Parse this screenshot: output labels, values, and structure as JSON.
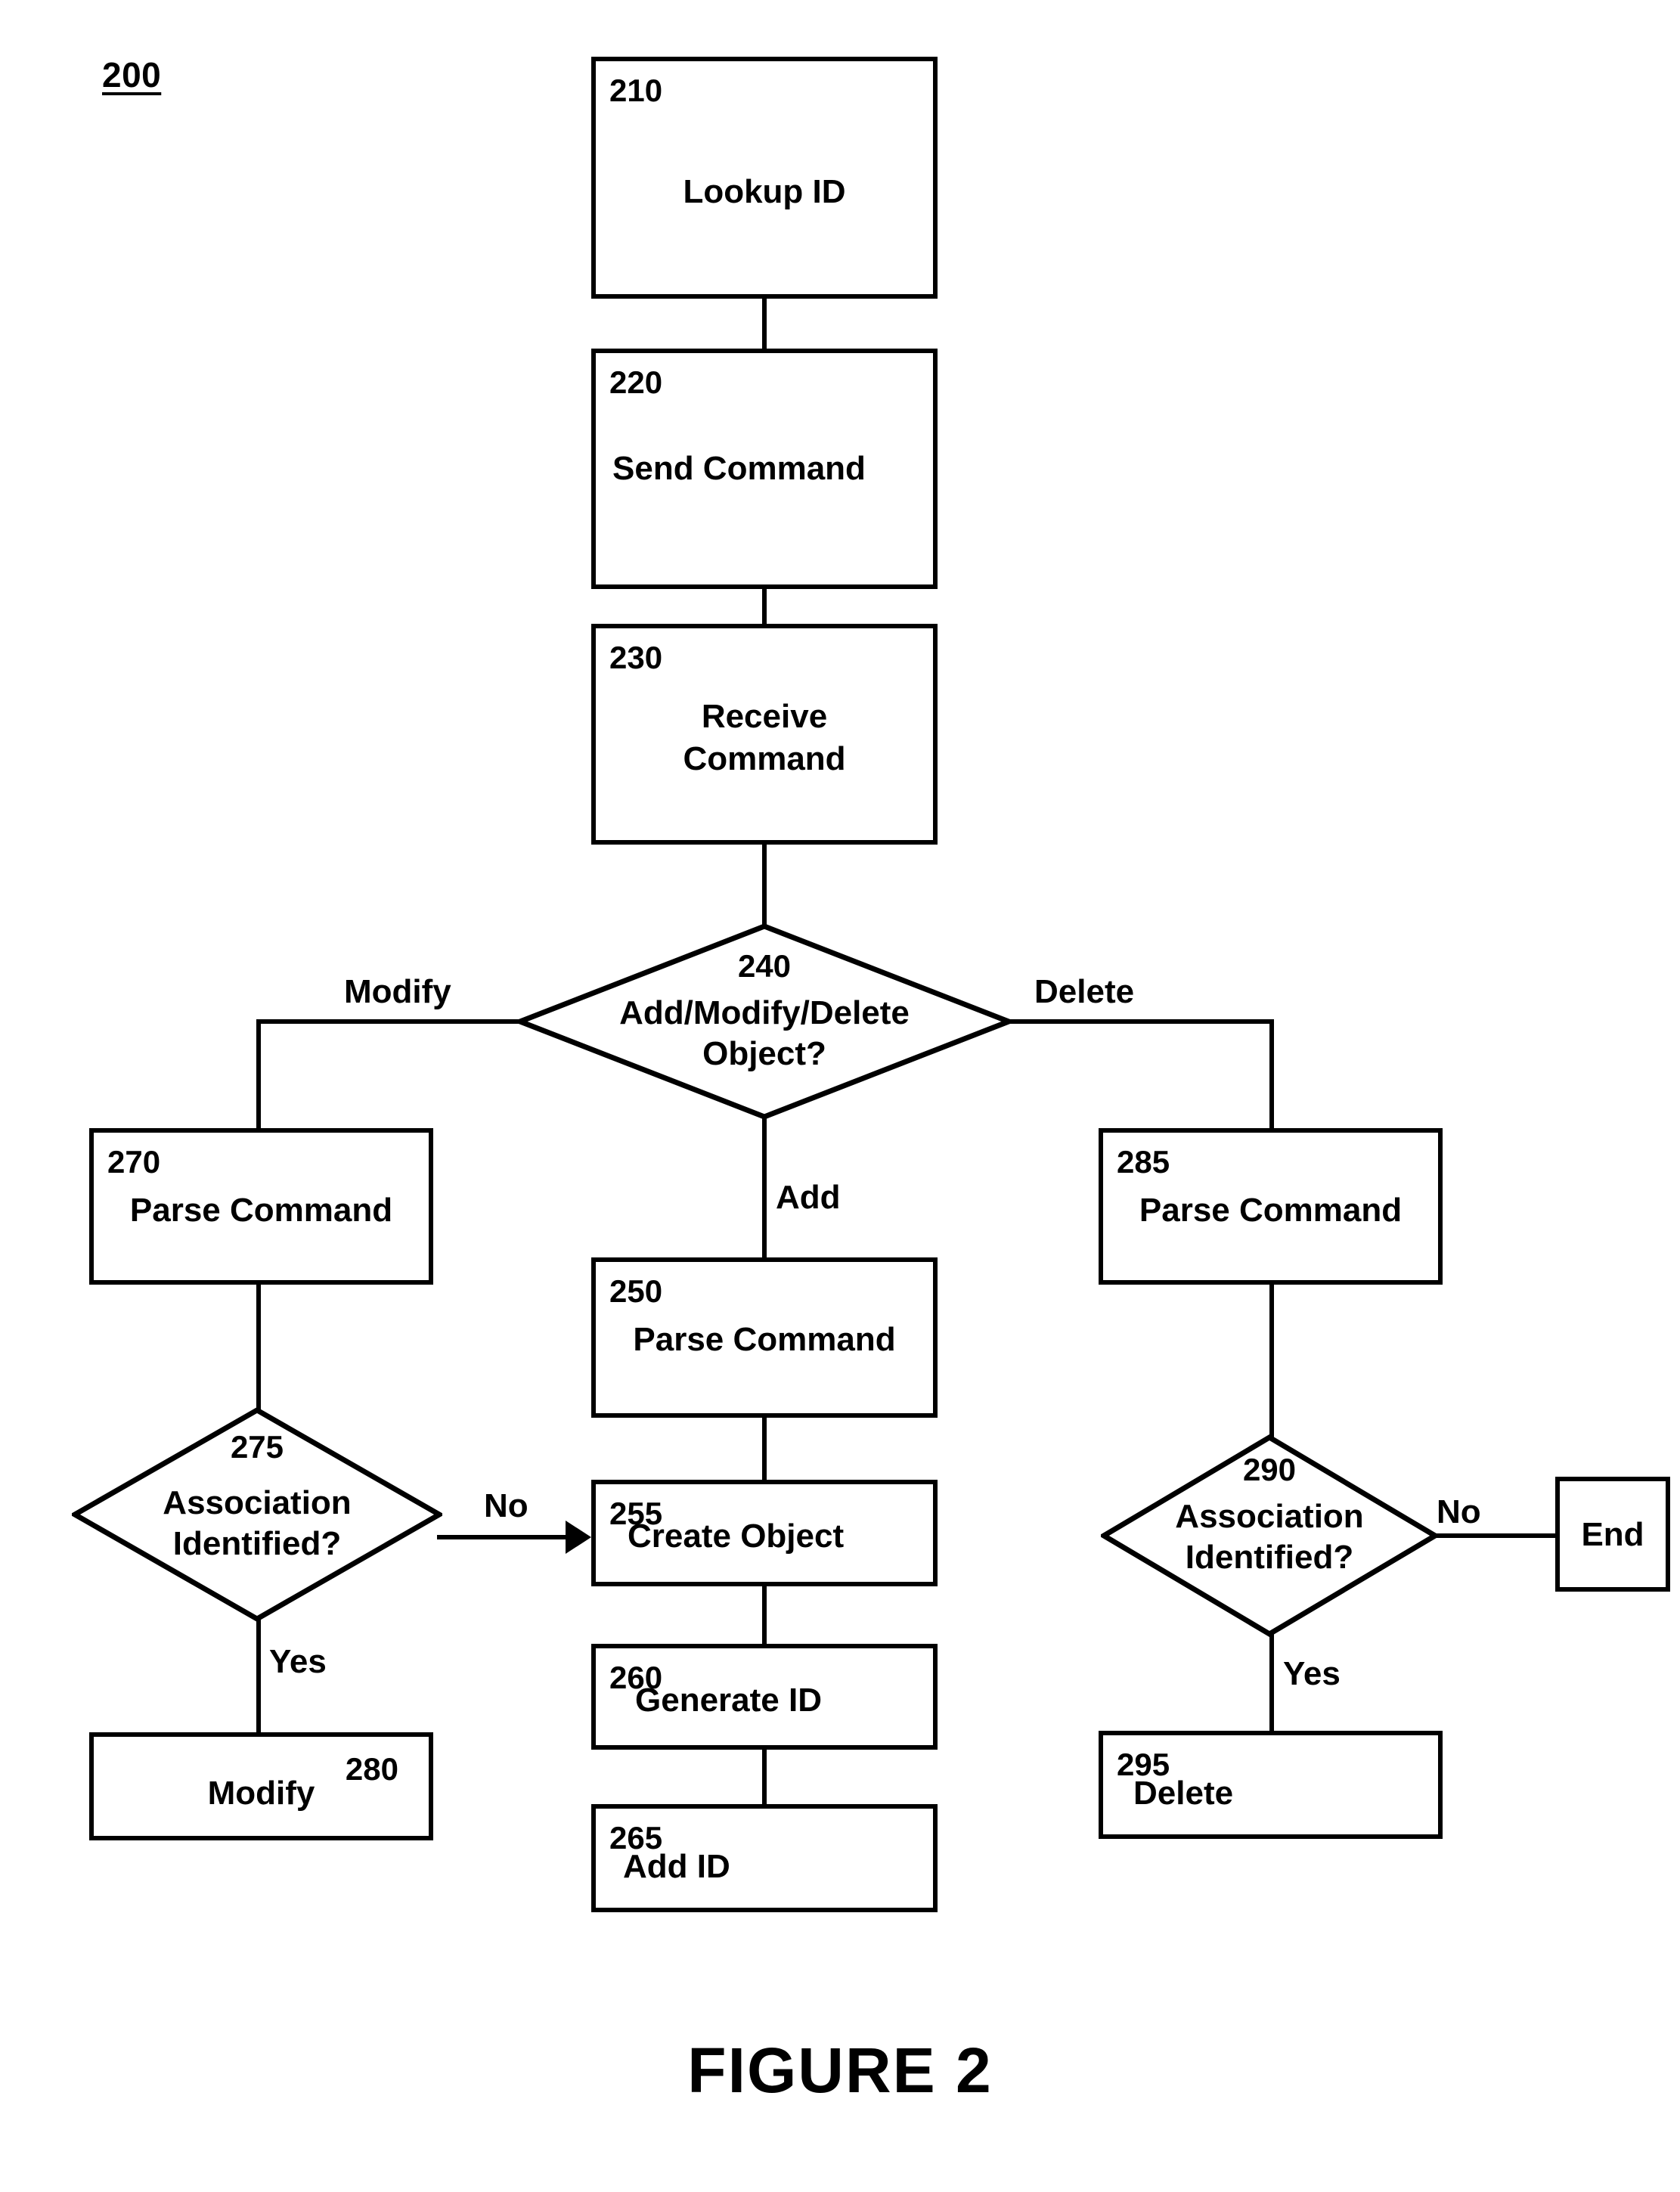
{
  "figure": {
    "reference_numeral": "200",
    "caption": "FIGURE 2"
  },
  "nodes": {
    "n210": {
      "number": "210",
      "label": "Lookup ID",
      "shape": "process"
    },
    "n220": {
      "number": "220",
      "label": "Send Command",
      "shape": "process"
    },
    "n230": {
      "number": "230",
      "label_line1": "Receive",
      "label_line2": "Command",
      "shape": "process"
    },
    "n240": {
      "number": "240",
      "label_line1": "Add/Modify/Delete",
      "label_line2": "Object?",
      "shape": "decision"
    },
    "n250": {
      "number": "250",
      "label": "Parse Command",
      "shape": "process"
    },
    "n255": {
      "number": "255",
      "label": "Create Object",
      "shape": "process"
    },
    "n260": {
      "number": "260",
      "label": "Generate ID",
      "shape": "process"
    },
    "n265": {
      "number": "265",
      "label": "Add ID",
      "shape": "process"
    },
    "n270": {
      "number": "270",
      "label": "Parse Command",
      "shape": "process"
    },
    "n275": {
      "number": "275",
      "label_line1": "Association",
      "label_line2": "Identified?",
      "shape": "decision"
    },
    "n280": {
      "number": "280",
      "label": "Modify",
      "shape": "process"
    },
    "n285": {
      "number": "285",
      "label": "Parse Command",
      "shape": "process"
    },
    "n290": {
      "number": "290",
      "label_line1": "Association",
      "label_line2": "Identified?",
      "shape": "decision"
    },
    "n295": {
      "number": "295",
      "label": "Delete",
      "shape": "process"
    },
    "nEnd": {
      "label": "End",
      "shape": "terminator"
    }
  },
  "edge_labels": {
    "modify": "Modify",
    "delete": "Delete",
    "add": "Add",
    "no_275": "No",
    "yes_275": "Yes",
    "no_290": "No",
    "yes_290": "Yes"
  },
  "style": {
    "stroke": "#000000",
    "fill": "#ffffff"
  }
}
